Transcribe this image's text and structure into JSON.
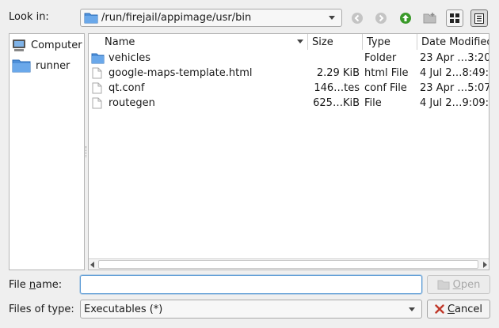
{
  "toolbar": {
    "look_in_label": "Look in:",
    "path": "/run/firejail/appimage/usr/bin"
  },
  "sidebar": {
    "items": [
      {
        "label": "Computer",
        "icon": "computer-icon"
      },
      {
        "label": "runner",
        "icon": "folder-icon"
      }
    ]
  },
  "file_list": {
    "columns": [
      "Name",
      "Size",
      "Type",
      "Date Modified"
    ],
    "rows": [
      {
        "name": "vehicles",
        "size": "",
        "type": "Folder",
        "date": "23 Apr …3:20",
        "icon": "folder-icon"
      },
      {
        "name": "google-maps-template.html",
        "size": "2.29 KiB",
        "type": "html File",
        "date": "4 Jul 2…8:49:",
        "icon": "file-icon"
      },
      {
        "name": "qt.conf",
        "size": "146…tes",
        "type": "conf File",
        "date": "23 Apr …5:07",
        "icon": "file-icon"
      },
      {
        "name": "routegen",
        "size": "625…KiB",
        "type": "File",
        "date": "4 Jul 2…9:09:",
        "icon": "file-icon"
      }
    ]
  },
  "footer": {
    "file_name_label_pre": "File ",
    "file_name_label_mn": "n",
    "file_name_label_post": "ame:",
    "file_name_value": "",
    "files_of_type_label": "Files of type:",
    "files_of_type_value": "Executables (*)",
    "open_label_mn": "O",
    "open_label_post": "pen",
    "cancel_label_mn": "C",
    "cancel_label_post": "ancel"
  },
  "colors": {
    "accent": "#5b9bd5",
    "folder": "#4d8fd9",
    "go_up_green": "#3a9a2a"
  }
}
